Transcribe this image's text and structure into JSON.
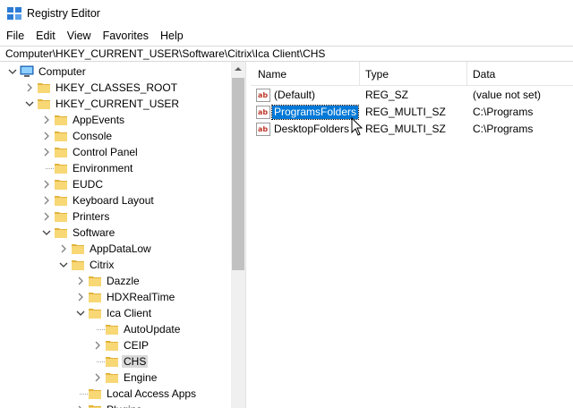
{
  "window": {
    "title": "Registry Editor"
  },
  "menu": [
    "File",
    "Edit",
    "View",
    "Favorites",
    "Help"
  ],
  "address": "Computer\\HKEY_CURRENT_USER\\Software\\Citrix\\Ica Client\\CHS",
  "tree": [
    {
      "label": "Computer",
      "depth": 0,
      "state": "expanded",
      "icon": "computer-icon"
    },
    {
      "label": "HKEY_CLASSES_ROOT",
      "depth": 1,
      "state": "collapsed",
      "icon": "folder-icon"
    },
    {
      "label": "HKEY_CURRENT_USER",
      "depth": 1,
      "state": "expanded",
      "icon": "folder-icon"
    },
    {
      "label": "AppEvents",
      "depth": 2,
      "state": "collapsed",
      "icon": "folder-icon"
    },
    {
      "label": "Console",
      "depth": 2,
      "state": "collapsed",
      "icon": "folder-icon"
    },
    {
      "label": "Control Panel",
      "depth": 2,
      "state": "collapsed",
      "icon": "folder-icon"
    },
    {
      "label": "Environment",
      "depth": 2,
      "state": "leaf",
      "icon": "folder-icon"
    },
    {
      "label": "EUDC",
      "depth": 2,
      "state": "collapsed",
      "icon": "folder-icon"
    },
    {
      "label": "Keyboard Layout",
      "depth": 2,
      "state": "collapsed",
      "icon": "folder-icon"
    },
    {
      "label": "Printers",
      "depth": 2,
      "state": "collapsed",
      "icon": "folder-icon"
    },
    {
      "label": "Software",
      "depth": 2,
      "state": "expanded",
      "icon": "folder-icon"
    },
    {
      "label": "AppDataLow",
      "depth": 3,
      "state": "collapsed",
      "icon": "folder-icon"
    },
    {
      "label": "Citrix",
      "depth": 3,
      "state": "expanded",
      "icon": "folder-icon"
    },
    {
      "label": "Dazzle",
      "depth": 4,
      "state": "collapsed",
      "icon": "folder-icon"
    },
    {
      "label": "HDXRealTime",
      "depth": 4,
      "state": "collapsed",
      "icon": "folder-icon"
    },
    {
      "label": "Ica Client",
      "depth": 4,
      "state": "expanded",
      "icon": "folder-icon"
    },
    {
      "label": "AutoUpdate",
      "depth": 5,
      "state": "leaf",
      "icon": "folder-icon"
    },
    {
      "label": "CEIP",
      "depth": 5,
      "state": "collapsed",
      "icon": "folder-icon"
    },
    {
      "label": "CHS",
      "depth": 5,
      "state": "leaf",
      "icon": "folder-icon",
      "selected": true
    },
    {
      "label": "Engine",
      "depth": 5,
      "state": "collapsed",
      "icon": "folder-icon"
    },
    {
      "label": "Local Access Apps",
      "depth": 4,
      "state": "leaf",
      "icon": "folder-icon"
    },
    {
      "label": "Plugins",
      "depth": 4,
      "state": "collapsed",
      "icon": "folder-icon"
    }
  ],
  "list": {
    "columns": [
      "Name",
      "Type",
      "Data"
    ],
    "rows": [
      {
        "name": "(Default)",
        "type": "REG_SZ",
        "data": "(value not set)",
        "icon": "string-value-icon",
        "selected": false
      },
      {
        "name": "ProgramsFolders",
        "type": "REG_MULTI_SZ",
        "data": "C:\\Programs",
        "icon": "string-value-icon",
        "selected": true
      },
      {
        "name": "DesktopFolders",
        "type": "REG_MULTI_SZ",
        "data": "C:\\Programs",
        "icon": "string-value-icon",
        "selected": false
      }
    ]
  },
  "colors": {
    "selection": "#0078d7",
    "tree_selection": "#d9d9d9",
    "folder": "#f8d775",
    "folder_dark": "#e2b33c"
  }
}
